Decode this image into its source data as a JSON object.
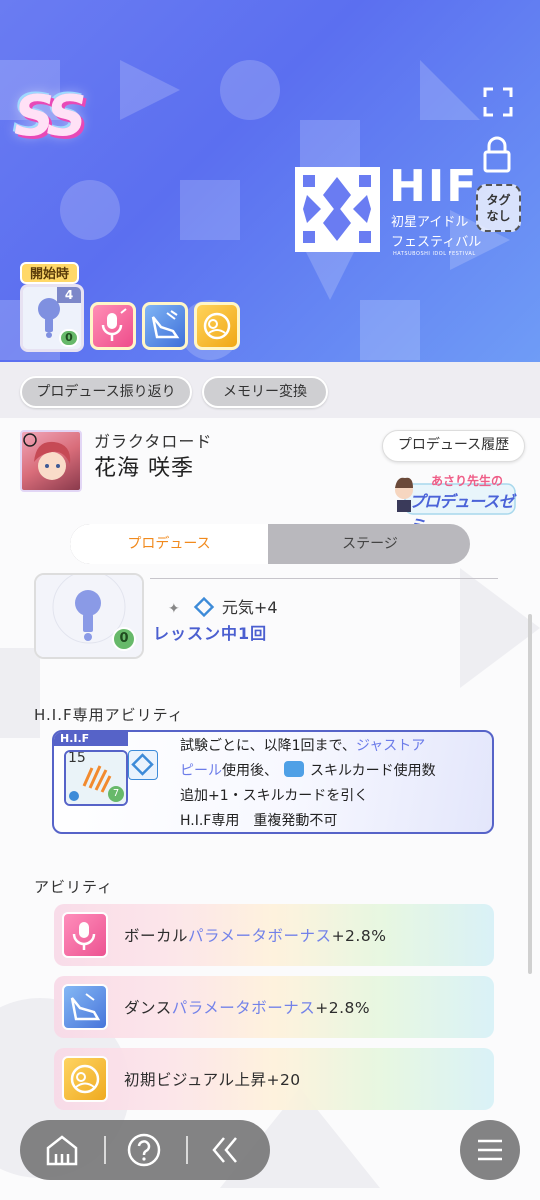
{
  "header": {
    "rank": "SS",
    "event": {
      "logo_text": "HIF",
      "name_line1": "初星アイドル",
      "name_line2": "フェスティバル",
      "subtitle": "HATSUBOSHI IDOL FESTIVAL"
    },
    "tag_badge": {
      "line1": "タグ",
      "line2": "なし"
    },
    "start_label": "開始時",
    "main_card": {
      "level": "4",
      "cost": "0"
    }
  },
  "actions": {
    "review_button": "プロデュース振り返り",
    "memory_button": "メモリー変換"
  },
  "idol": {
    "subtitle": "ガラクタロード",
    "name": "花海 咲季",
    "history_button": "プロデュース履歴",
    "seminar_banner": {
      "top": "あさり先生の",
      "main": "プロデュースゼミ"
    }
  },
  "tabs": [
    {
      "label": "プロデュース",
      "active": true
    },
    {
      "label": "ステージ",
      "active": false
    }
  ],
  "skill": {
    "effect": "元気+4",
    "condition": "レッスン中1回",
    "cost": "0"
  },
  "hif_ability": {
    "section_title": "H.I.F専用アビリティ",
    "tag": "H.I.F",
    "card_level": "15",
    "card_cost": "7",
    "text_line1_a": "試験ごとに、以降1回まで、",
    "text_line1_b": "ジャストア",
    "text_line2_a": "ピール",
    "text_line2_b": "使用後、",
    "text_line2_c": "スキルカード使用数",
    "text_line3": "追加+1・スキルカードを引く",
    "text_line4": "H.I.F専用　重複発動不可"
  },
  "abilities": {
    "section_title": "アビリティ",
    "items": [
      {
        "prefix": "ボーカル",
        "highlight": "パラメータボーナス",
        "suffix": "+2.8%",
        "color": "#ef4e93",
        "icon": "vocal-mic-icon"
      },
      {
        "prefix": "ダンス",
        "highlight": "パラメータボーナス",
        "suffix": "+2.8%",
        "color": "#4d86e6",
        "icon": "dance-shoe-icon"
      },
      {
        "prefix": "初期ビジュアル上昇+20",
        "highlight": "",
        "suffix": "",
        "color": "#f3b51d",
        "icon": "visual-icon"
      }
    ]
  },
  "colors": {
    "header_gradient_start": "#6a7cf2",
    "header_gradient_end": "#6f9cf6",
    "active_tab_text": "#f18a1d",
    "highlight_blue": "#6c7ce9",
    "hif_border": "#5663c8"
  }
}
